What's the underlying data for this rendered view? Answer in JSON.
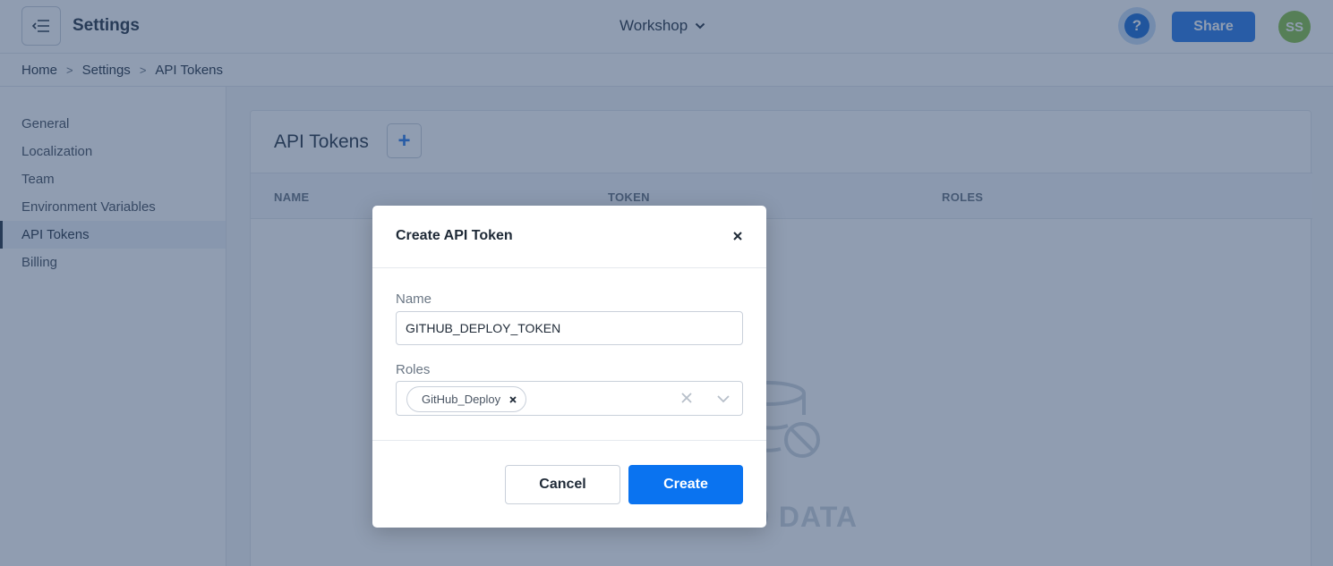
{
  "header": {
    "title": "Settings",
    "workspace": "Workshop",
    "help_label": "?",
    "share_label": "Share",
    "avatar_initials": "SS"
  },
  "breadcrumb": [
    "Home",
    "Settings",
    "API Tokens"
  ],
  "sidebar": {
    "items": [
      {
        "label": "General"
      },
      {
        "label": "Localization"
      },
      {
        "label": "Team"
      },
      {
        "label": "Environment Variables"
      },
      {
        "label": "API Tokens",
        "active": true
      },
      {
        "label": "Billing"
      }
    ]
  },
  "main": {
    "title": "API Tokens",
    "add_label": "+",
    "columns": [
      "NAME",
      "TOKEN",
      "ROLES"
    ],
    "empty_text": "NO DATA"
  },
  "modal": {
    "title": "Create API Token",
    "name_label": "Name",
    "name_value": "GITHUB_DEPLOY_TOKEN",
    "roles_label": "Roles",
    "roles": [
      "GitHub_Deploy"
    ],
    "cancel_label": "Cancel",
    "create_label": "Create"
  },
  "colors": {
    "accent": "#0a73f0",
    "share": "#2f7ce8",
    "avatar": "#8bc34a",
    "overlay": "rgba(34,60,100,0.5)"
  }
}
